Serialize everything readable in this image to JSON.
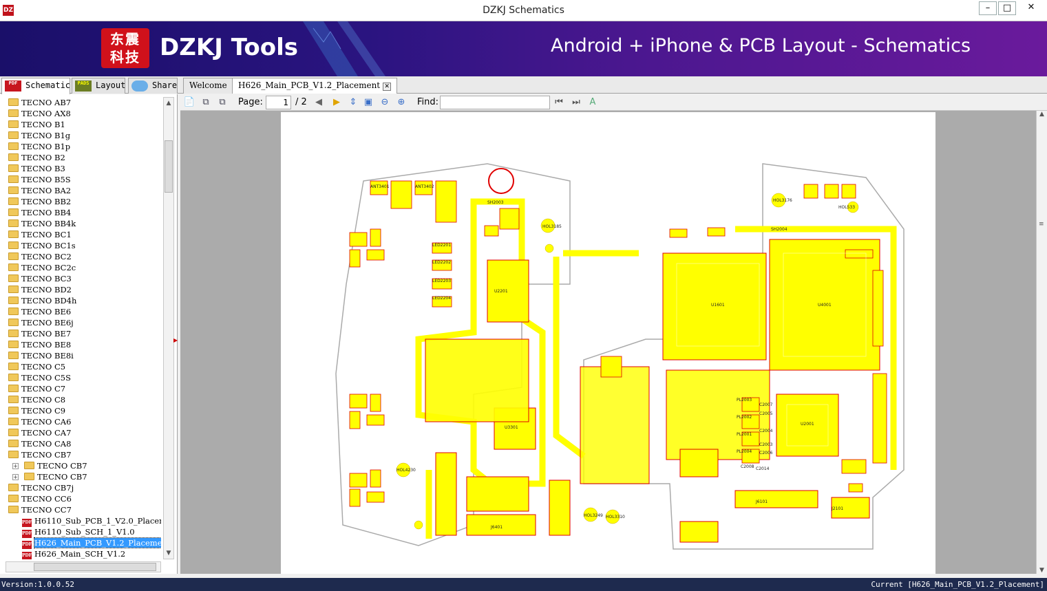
{
  "window": {
    "title": "DZKJ Schematics",
    "icon": "DZ"
  },
  "banner": {
    "logo_text_top": "东震",
    "logo_text_bottom": "科技",
    "brand": "DZKJ Tools",
    "slogan": "Android + iPhone & PCB Layout - Schematics"
  },
  "main_tabs": [
    {
      "label": "Schematic",
      "icon": "PDF"
    },
    {
      "label": "Layout",
      "icon": "PADS"
    },
    {
      "label": "Share",
      "icon": "cloud-icon"
    }
  ],
  "doc_tabs": [
    {
      "label": "Welcome"
    },
    {
      "label": "H626_Main_PCB_V1.2_Placement"
    }
  ],
  "tree": [
    {
      "label": "TECNO AB7"
    },
    {
      "label": "TECNO AX8"
    },
    {
      "label": "TECNO B1"
    },
    {
      "label": "TECNO B1g"
    },
    {
      "label": "TECNO B1p"
    },
    {
      "label": "TECNO B2"
    },
    {
      "label": "TECNO B3"
    },
    {
      "label": "TECNO B5S"
    },
    {
      "label": "TECNO BA2"
    },
    {
      "label": "TECNO BB2"
    },
    {
      "label": "TECNO BB4"
    },
    {
      "label": "TECNO BB4k"
    },
    {
      "label": "TECNO BC1"
    },
    {
      "label": "TECNO BC1s"
    },
    {
      "label": "TECNO BC2"
    },
    {
      "label": "TECNO BC2c"
    },
    {
      "label": "TECNO BC3"
    },
    {
      "label": "TECNO BD2"
    },
    {
      "label": "TECNO BD4h"
    },
    {
      "label": "TECNO BE6"
    },
    {
      "label": "TECNO BE6j"
    },
    {
      "label": "TECNO BE7"
    },
    {
      "label": "TECNO BE8"
    },
    {
      "label": "TECNO BE8i"
    },
    {
      "label": "TECNO C5"
    },
    {
      "label": "TECNO C5S"
    },
    {
      "label": "TECNO C7"
    },
    {
      "label": "TECNO C8"
    },
    {
      "label": "TECNO C9"
    },
    {
      "label": "TECNO CA6"
    },
    {
      "label": "TECNO CA7"
    },
    {
      "label": "TECNO CA8"
    },
    {
      "label": "TECNO CB7"
    },
    {
      "label": "TECNO CB7"
    },
    {
      "label": "TECNO CB7"
    },
    {
      "label": "TECNO CB7j"
    },
    {
      "label": "TECNO CC6"
    },
    {
      "label": "TECNO CC7"
    },
    {
      "label": "H6110_Sub_PCB_1_V2.0_Placement"
    },
    {
      "label": "H6110_Sub_SCH_1_V1.0"
    },
    {
      "label": "H626_Main_PCB_V1.2_Placement"
    },
    {
      "label": "H626_Main_SCH_V1.2"
    }
  ],
  "toolbar": {
    "page_label": "Page:",
    "page_current": "1",
    "page_total": "/ 2",
    "find_label": "Find:",
    "find_value": ""
  },
  "pcb": {
    "labels": [
      "SH2003",
      "SH2004",
      "U2201",
      "U3301",
      "U4001",
      "U2001",
      "U1601",
      "J6401",
      "J6101",
      "J2101",
      "PL2001",
      "PL2002",
      "PL2003",
      "PL2004",
      "LED2201",
      "LED2202",
      "LED2203",
      "LED2204",
      "HOL3185",
      "HOL3176",
      "HOL3310",
      "HOL3249",
      "HOL4230",
      "HOL533",
      "ANT3401",
      "ANT3402",
      "C2008",
      "C2014",
      "C2007",
      "C2005",
      "C2004",
      "C2003",
      "C2006"
    ]
  },
  "status": {
    "version": "Version:1.0.0.52",
    "current": "Current [H626_Main_PCB_V1.2_Placement]"
  }
}
